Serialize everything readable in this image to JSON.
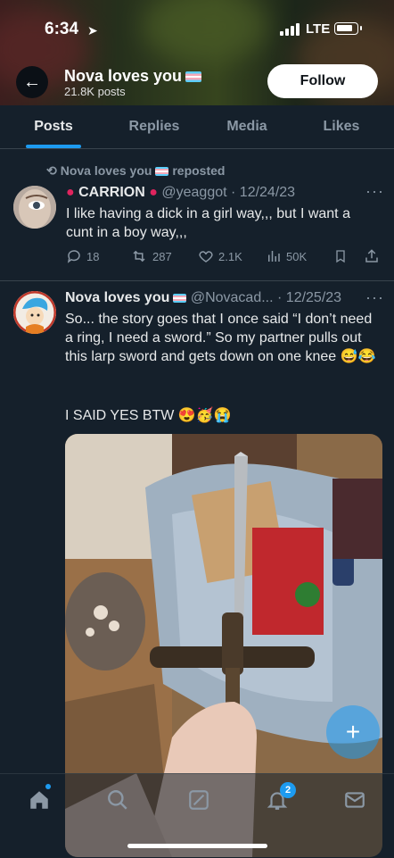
{
  "status": {
    "time": "6:34",
    "network": "LTE"
  },
  "header": {
    "name": "Nova loves you",
    "posts_count": "21.8K posts",
    "follow_label": "Follow"
  },
  "tabs": [
    {
      "label": "Posts"
    },
    {
      "label": "Replies"
    },
    {
      "label": "Media"
    },
    {
      "label": "Likes"
    }
  ],
  "tweets": [
    {
      "repost_label": "Nova loves you",
      "repost_suffix": "reposted",
      "name": "CARRION",
      "handle": "@yeaggot",
      "date": "· 12/24/23",
      "text": "I like having a dick in a girl way,,, but I want a cunt in a boy way,,,",
      "replies": "18",
      "reposts": "287",
      "likes": "2.1K",
      "views": "50K"
    },
    {
      "name": "Nova loves you",
      "handle": "@Novacad...",
      "date": "· 12/25/23",
      "text": "So... the story goes that I once said “I don’t need a ring, I need a sword.” So my partner pulls out this larp sword and gets down on one knee 😅😂",
      "text2": "I SAID YES BTW 😍🥳😭"
    }
  ],
  "nav": {
    "notifications_badge": "2"
  },
  "colors": {
    "accent": "#1d9bf0",
    "background": "#15202b",
    "muted": "#8b98a5"
  }
}
